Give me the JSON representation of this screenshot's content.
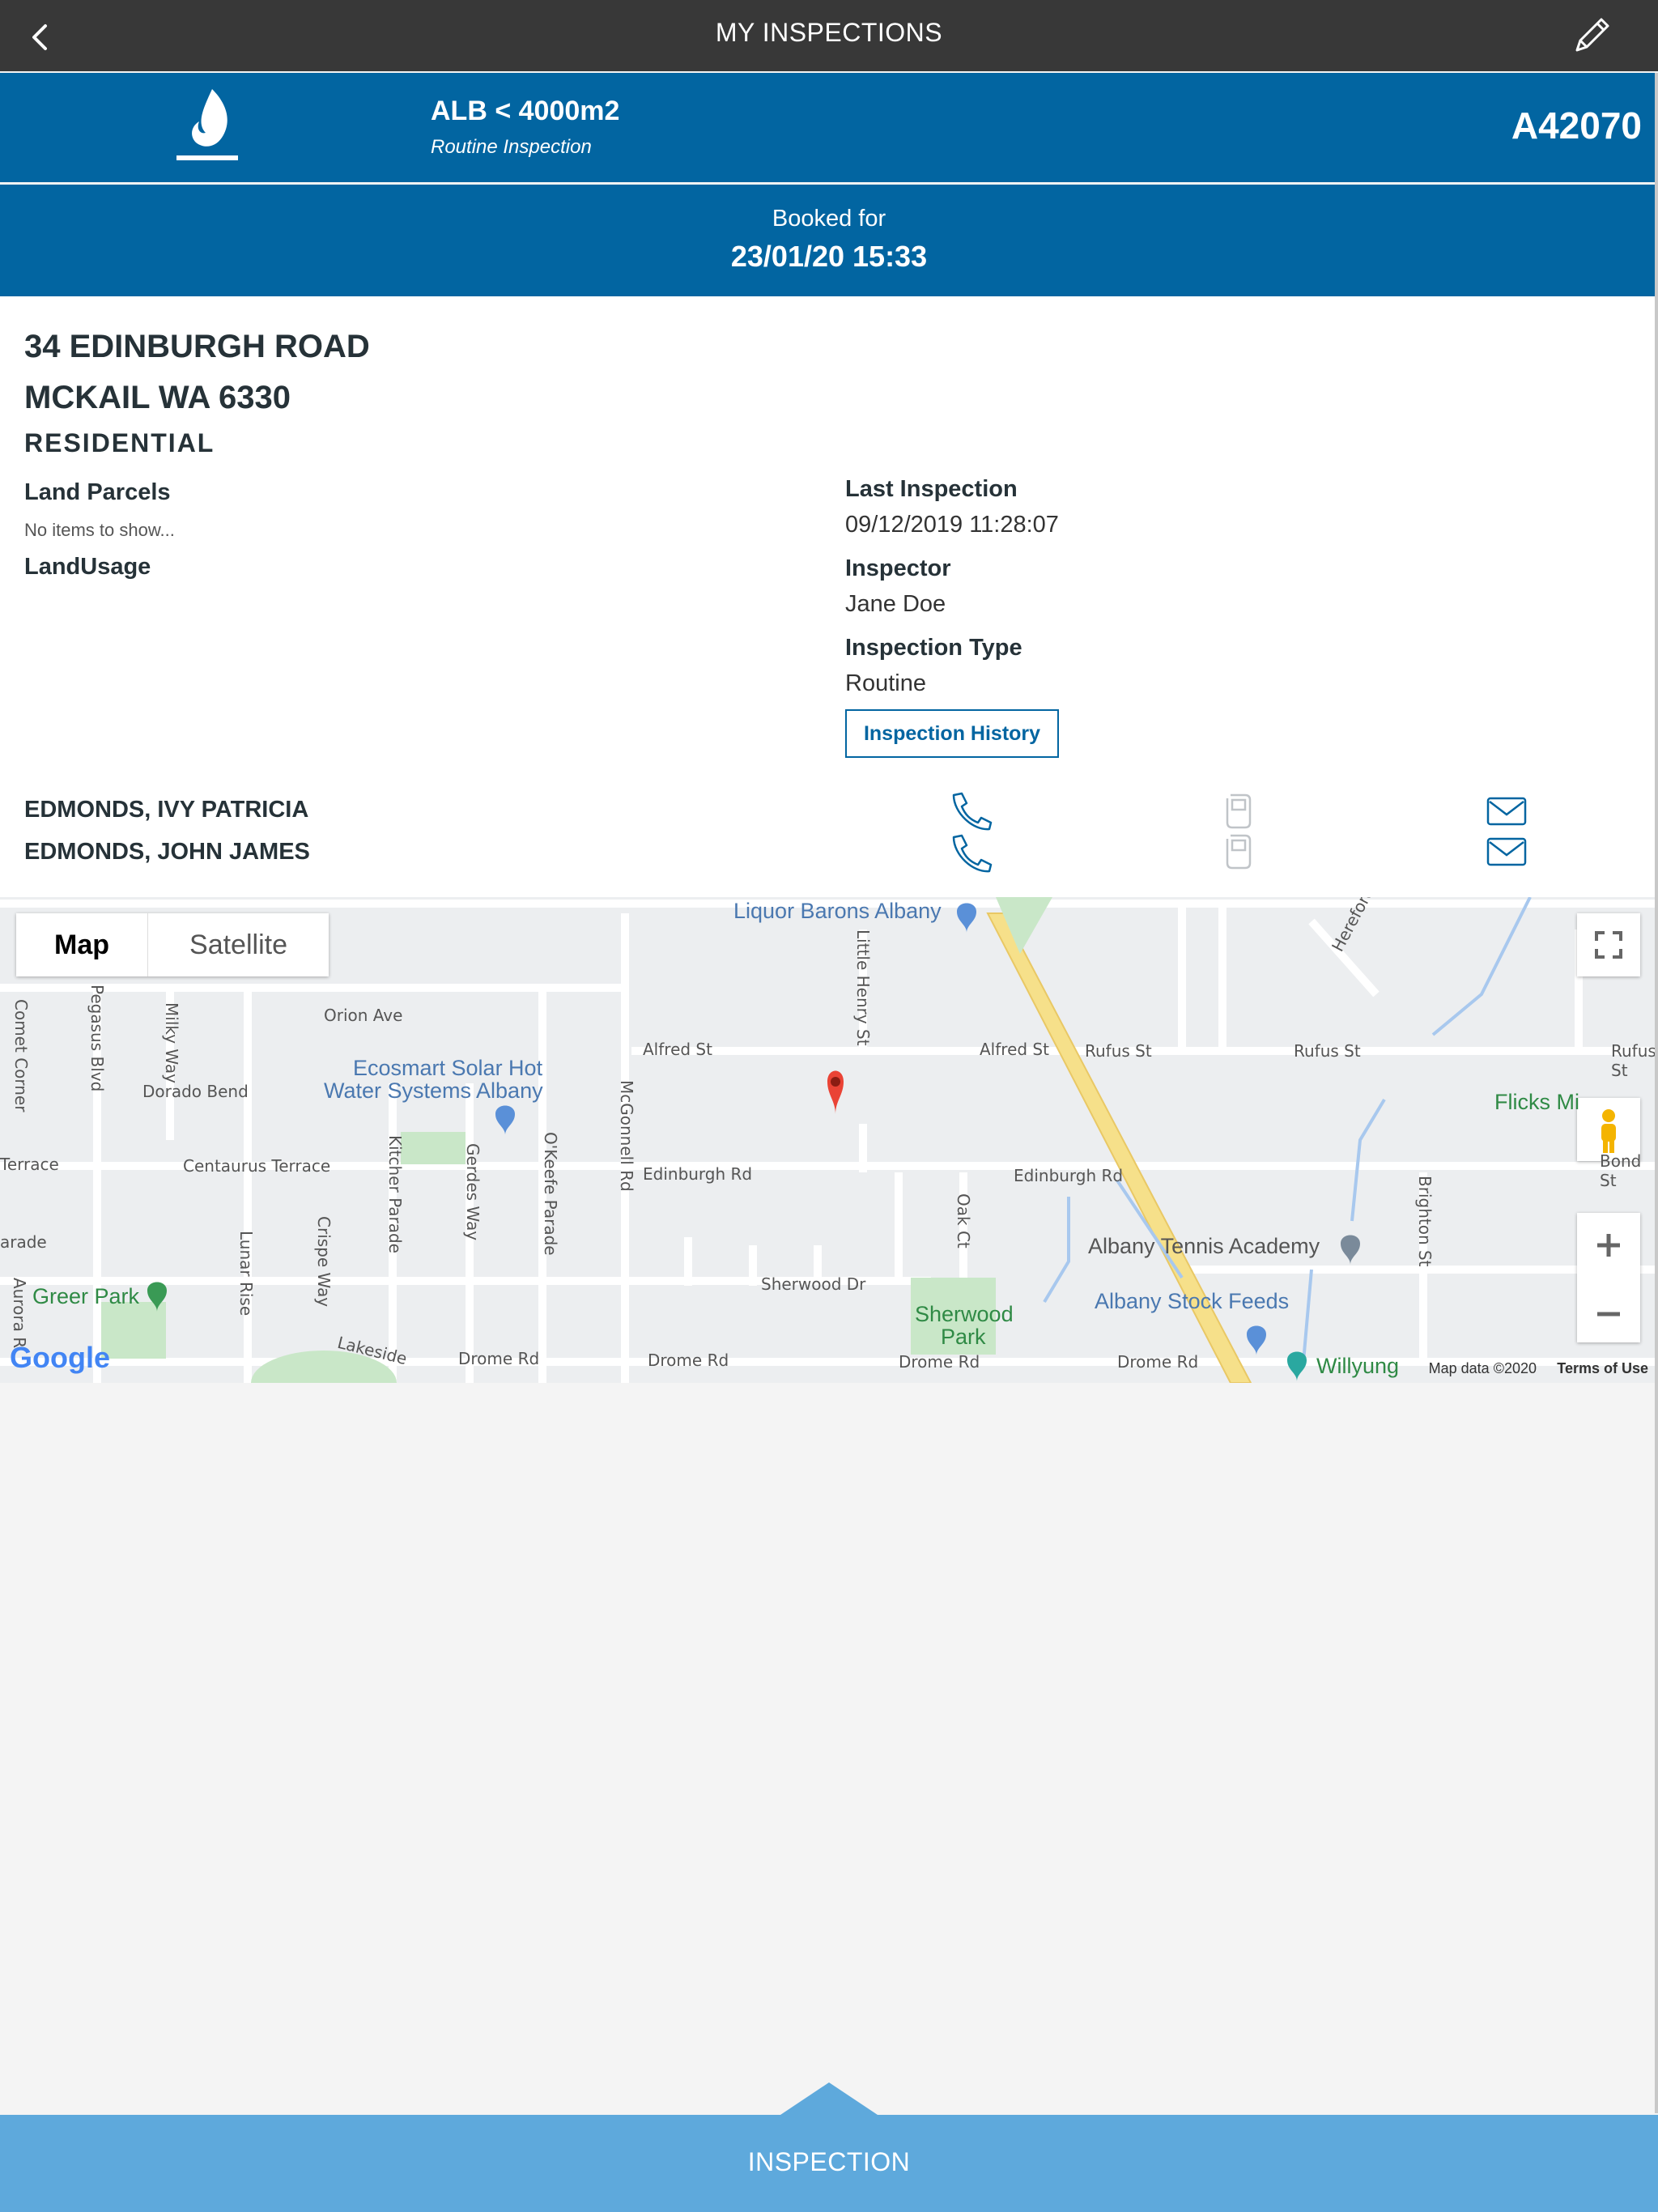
{
  "header": {
    "title": "MY INSPECTIONS"
  },
  "inspection": {
    "type": "ALB < 4000m2",
    "subtype": "Routine Inspection",
    "code": "A42070",
    "booked_label": "Booked for",
    "booked_value": "23/01/20 15:33"
  },
  "property": {
    "address_line1": "34 EDINBURGH ROAD",
    "address_line2": "MCKAIL WA 6330",
    "category": "RESIDENTIAL",
    "land_parcels_label": "Land Parcels",
    "land_parcels_empty": "No items to show...",
    "land_usage_label": "LandUsage"
  },
  "history": {
    "last_inspection_label": "Last Inspection",
    "last_inspection_value": "09/12/2019 11:28:07",
    "inspector_label": "Inspector",
    "inspector_value": "Jane Doe",
    "inspection_type_label": "Inspection Type",
    "inspection_type_value": "Routine",
    "history_button": "Inspection History"
  },
  "contacts": [
    {
      "name": "EDMONDS, IVY PATRICIA"
    },
    {
      "name": "EDMONDS, JOHN JAMES"
    }
  ],
  "map": {
    "map_label": "Map",
    "satellite_label": "Satellite",
    "google": "Google",
    "copyright": "Map data ©2020",
    "terms": "Terms of Use",
    "pois": [
      "Liquor Barons Albany",
      "Ecosmart Solar Hot",
      "Water Systems Albany",
      "Flicks Mi",
      "Albany Tennis Academy",
      "Albany Stock Feeds",
      "Sherwood",
      "Park",
      "Greer Park",
      "Willyung"
    ],
    "streets": [
      "Orion Ave",
      "Comet Corner",
      "Pegasus Blvd",
      "Milky Way",
      "Dorado Bend",
      "Terrace",
      "Centaurus Terrace",
      "arade",
      "Lunar Rise",
      "Crispe Way",
      "Kitcher Parade",
      "Gerdes Way",
      "O'Keefe Parade",
      "McGonnell Rd",
      "Alfred St",
      "Little Henry St",
      "Alfred St",
      "Rufus St",
      "Rufus St",
      "Rufus St",
      "Edinburgh Rd",
      "Edinburgh Rd",
      "Oak Ct",
      "Sherwood Dr",
      "Drome Rd",
      "Drome Rd",
      "Drome Rd",
      "Drome Rd",
      "Hereford Way",
      "Brighton St",
      "Bond St",
      "Lakeside",
      "Aurora R"
    ]
  },
  "bottom": {
    "tab_label": "INSPECTION"
  },
  "colors": {
    "topbar": "#383838",
    "brand": "#0265a1",
    "bottom": "#5ea9dc",
    "pin": "#ea4335"
  }
}
